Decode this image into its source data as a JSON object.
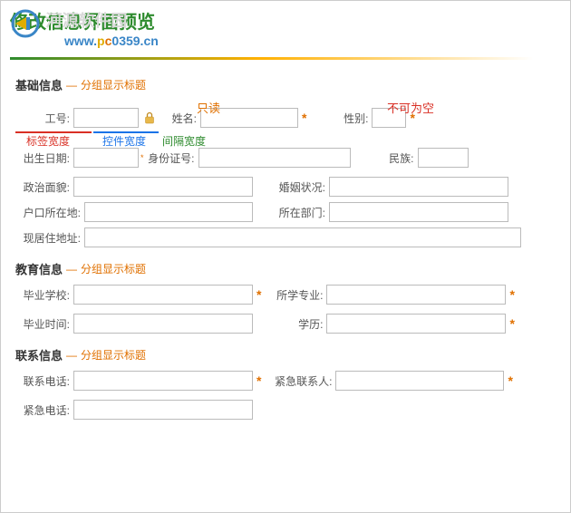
{
  "header": {
    "title": "修改信息界面预览",
    "watermark_text": "河源软件园",
    "url_w": "w",
    "url_w2": "ww.",
    "url_p": "p",
    "url_c": "c",
    "url_rest": "0359.cn"
  },
  "annotations": {
    "readonly": "只读",
    "required": "不可为空",
    "label_width": "标签宽度",
    "control_width": "控件宽度",
    "gap_width": "间隔宽度"
  },
  "sections": {
    "basic": {
      "title": "基础信息",
      "note": "分组显示标题"
    },
    "edu": {
      "title": "教育信息",
      "note": "分组显示标题"
    },
    "contact": {
      "title": "联系信息",
      "note": "分组显示标题"
    }
  },
  "fields": {
    "emp_no": "工号:",
    "name": "姓名:",
    "gender": "性别:",
    "birth": "出生日期:",
    "id_card": "身份证号:",
    "ethnic": "民族:",
    "political": "政治面貌:",
    "marital": "婚姻状况:",
    "hukou": "户口所在地:",
    "dept": "所在部门:",
    "address": "现居住地址:",
    "school": "毕业学校:",
    "major": "所学专业:",
    "grad_time": "毕业时间:",
    "degree": "学历:",
    "phone": "联系电话:",
    "emergency_contact": "紧急联系人:",
    "emergency_phone": "紧急电话:"
  },
  "star": "*",
  "dash": "—"
}
